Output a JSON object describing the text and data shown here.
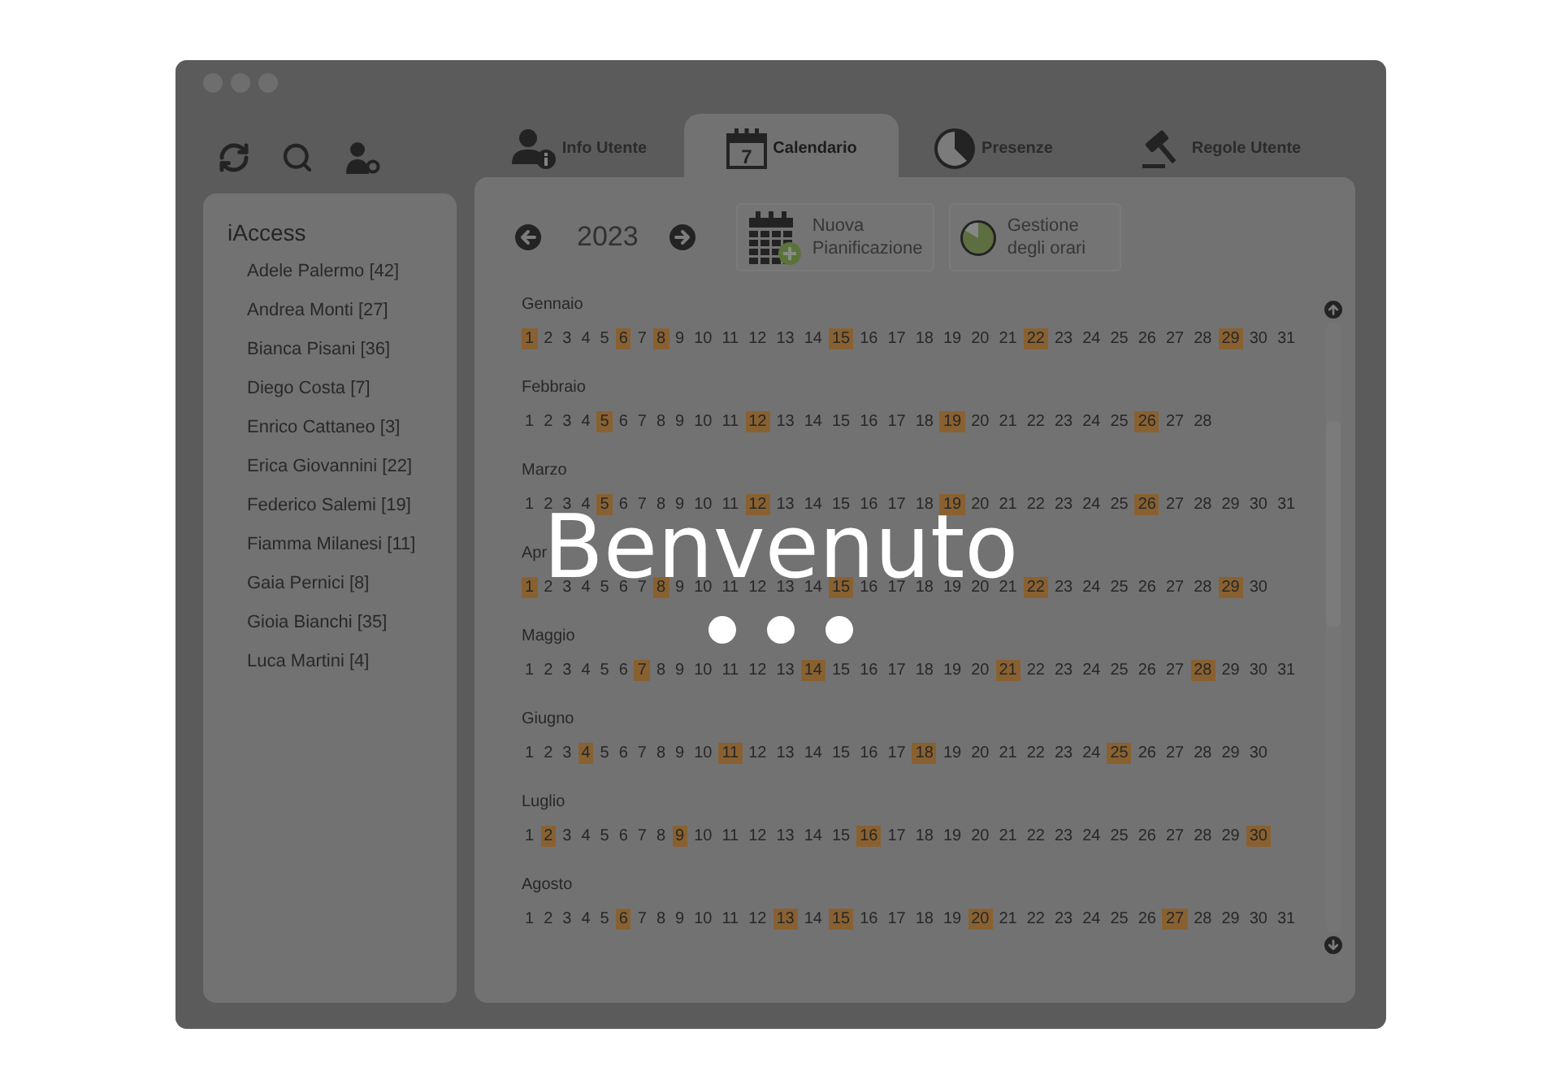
{
  "sidebar": {
    "title": "iAccess",
    "items": [
      "Adele Palermo [42]",
      "Andrea Monti [27]",
      "Bianca Pisani [36]",
      "Diego Costa [7]",
      "Enrico Cattaneo [3]",
      "Erica Giovannini [22]",
      "Federico Salemi [19]",
      "Fiamma Milanesi [11]",
      "Gaia Pernici [8]",
      "Gioia Bianchi [35]",
      "Luca Martini [4]"
    ]
  },
  "tabs": [
    {
      "label": "Info Utente",
      "kind": "user",
      "selected": false
    },
    {
      "label": "Calendario",
      "kind": "calendar",
      "icon_text": "7",
      "selected": true
    },
    {
      "label": "Presenze",
      "kind": "clock",
      "selected": false
    },
    {
      "label": "Regole Utente",
      "kind": "gavel",
      "selected": false
    }
  ],
  "year_nav": {
    "year": "2023"
  },
  "actions": [
    {
      "label": "Nuova Pianificazione",
      "kind": "schedule"
    },
    {
      "label": "Gestione degli orari",
      "kind": "hours"
    }
  ],
  "calendar": {
    "months": [
      {
        "name": "Gennaio",
        "days": [
          {
            "day": "1",
            "marked": true
          },
          {
            "day": "2",
            "marked": false
          },
          {
            "day": "3",
            "marked": false
          },
          {
            "day": "4",
            "marked": false
          },
          {
            "day": "5",
            "marked": false
          },
          {
            "day": "6",
            "marked": true
          },
          {
            "day": "7",
            "marked": false
          },
          {
            "day": "8",
            "marked": true
          },
          {
            "day": "9",
            "marked": false
          },
          {
            "day": "10",
            "marked": false
          },
          {
            "day": "11",
            "marked": false
          },
          {
            "day": "12",
            "marked": false
          },
          {
            "day": "13",
            "marked": false
          },
          {
            "day": "14",
            "marked": false
          },
          {
            "day": "15",
            "marked": true
          },
          {
            "day": "16",
            "marked": false
          },
          {
            "day": "17",
            "marked": false
          },
          {
            "day": "18",
            "marked": false
          },
          {
            "day": "19",
            "marked": false
          },
          {
            "day": "20",
            "marked": false
          },
          {
            "day": "21",
            "marked": false
          },
          {
            "day": "22",
            "marked": true
          },
          {
            "day": "23",
            "marked": false
          },
          {
            "day": "24",
            "marked": false
          },
          {
            "day": "25",
            "marked": false
          },
          {
            "day": "26",
            "marked": false
          },
          {
            "day": "27",
            "marked": false
          },
          {
            "day": "28",
            "marked": false
          },
          {
            "day": "29",
            "marked": true
          },
          {
            "day": "30",
            "marked": false
          },
          {
            "day": "31",
            "marked": false
          }
        ]
      },
      {
        "name": "Febbraio",
        "days": [
          {
            "day": "1",
            "marked": false
          },
          {
            "day": "2",
            "marked": false
          },
          {
            "day": "3",
            "marked": false
          },
          {
            "day": "4",
            "marked": false
          },
          {
            "day": "5",
            "marked": true
          },
          {
            "day": "6",
            "marked": false
          },
          {
            "day": "7",
            "marked": false
          },
          {
            "day": "8",
            "marked": false
          },
          {
            "day": "9",
            "marked": false
          },
          {
            "day": "10",
            "marked": false
          },
          {
            "day": "11",
            "marked": false
          },
          {
            "day": "12",
            "marked": true
          },
          {
            "day": "13",
            "marked": false
          },
          {
            "day": "14",
            "marked": false
          },
          {
            "day": "15",
            "marked": false
          },
          {
            "day": "16",
            "marked": false
          },
          {
            "day": "17",
            "marked": false
          },
          {
            "day": "18",
            "marked": false
          },
          {
            "day": "19",
            "marked": true
          },
          {
            "day": "20",
            "marked": false
          },
          {
            "day": "21",
            "marked": false
          },
          {
            "day": "22",
            "marked": false
          },
          {
            "day": "23",
            "marked": false
          },
          {
            "day": "24",
            "marked": false
          },
          {
            "day": "25",
            "marked": false
          },
          {
            "day": "26",
            "marked": true
          },
          {
            "day": "27",
            "marked": false
          },
          {
            "day": "28",
            "marked": false
          }
        ]
      },
      {
        "name": "Marzo",
        "days": [
          {
            "day": "1",
            "marked": false
          },
          {
            "day": "2",
            "marked": false
          },
          {
            "day": "3",
            "marked": false
          },
          {
            "day": "4",
            "marked": false
          },
          {
            "day": "5",
            "marked": true
          },
          {
            "day": "6",
            "marked": false
          },
          {
            "day": "7",
            "marked": false
          },
          {
            "day": "8",
            "marked": false
          },
          {
            "day": "9",
            "marked": false
          },
          {
            "day": "10",
            "marked": false
          },
          {
            "day": "11",
            "marked": false
          },
          {
            "day": "12",
            "marked": true
          },
          {
            "day": "13",
            "marked": false
          },
          {
            "day": "14",
            "marked": false
          },
          {
            "day": "15",
            "marked": false
          },
          {
            "day": "16",
            "marked": false
          },
          {
            "day": "17",
            "marked": false
          },
          {
            "day": "18",
            "marked": false
          },
          {
            "day": "19",
            "marked": true
          },
          {
            "day": "20",
            "marked": false
          },
          {
            "day": "21",
            "marked": false
          },
          {
            "day": "22",
            "marked": false
          },
          {
            "day": "23",
            "marked": false
          },
          {
            "day": "24",
            "marked": false
          },
          {
            "day": "25",
            "marked": false
          },
          {
            "day": "26",
            "marked": true
          },
          {
            "day": "27",
            "marked": false
          },
          {
            "day": "28",
            "marked": false
          },
          {
            "day": "29",
            "marked": false
          },
          {
            "day": "30",
            "marked": false
          },
          {
            "day": "31",
            "marked": false
          }
        ]
      },
      {
        "name": "Apr",
        "days": [
          {
            "day": "1",
            "marked": true
          },
          {
            "day": "2",
            "marked": false
          },
          {
            "day": "3",
            "marked": false
          },
          {
            "day": "4",
            "marked": false
          },
          {
            "day": "5",
            "marked": false
          },
          {
            "day": "6",
            "marked": false
          },
          {
            "day": "7",
            "marked": false
          },
          {
            "day": "8",
            "marked": true
          },
          {
            "day": "9",
            "marked": false
          },
          {
            "day": "10",
            "marked": false
          },
          {
            "day": "11",
            "marked": false
          },
          {
            "day": "12",
            "marked": false
          },
          {
            "day": "13",
            "marked": false
          },
          {
            "day": "14",
            "marked": false
          },
          {
            "day": "15",
            "marked": true
          },
          {
            "day": "16",
            "marked": false
          },
          {
            "day": "17",
            "marked": false
          },
          {
            "day": "18",
            "marked": false
          },
          {
            "day": "19",
            "marked": false
          },
          {
            "day": "20",
            "marked": false
          },
          {
            "day": "21",
            "marked": false
          },
          {
            "day": "22",
            "marked": true
          },
          {
            "day": "23",
            "marked": false
          },
          {
            "day": "24",
            "marked": false
          },
          {
            "day": "25",
            "marked": false
          },
          {
            "day": "26",
            "marked": false
          },
          {
            "day": "27",
            "marked": false
          },
          {
            "day": "28",
            "marked": false
          },
          {
            "day": "29",
            "marked": true
          },
          {
            "day": "30",
            "marked": false
          }
        ]
      },
      {
        "name": "Maggio",
        "days": [
          {
            "day": "1",
            "marked": false
          },
          {
            "day": "2",
            "marked": false
          },
          {
            "day": "3",
            "marked": false
          },
          {
            "day": "4",
            "marked": false
          },
          {
            "day": "5",
            "marked": false
          },
          {
            "day": "6",
            "marked": false
          },
          {
            "day": "7",
            "marked": true
          },
          {
            "day": "8",
            "marked": false
          },
          {
            "day": "9",
            "marked": false
          },
          {
            "day": "10",
            "marked": false
          },
          {
            "day": "11",
            "marked": false
          },
          {
            "day": "12",
            "marked": false
          },
          {
            "day": "13",
            "marked": false
          },
          {
            "day": "14",
            "marked": true
          },
          {
            "day": "15",
            "marked": false
          },
          {
            "day": "16",
            "marked": false
          },
          {
            "day": "17",
            "marked": false
          },
          {
            "day": "18",
            "marked": false
          },
          {
            "day": "19",
            "marked": false
          },
          {
            "day": "20",
            "marked": false
          },
          {
            "day": "21",
            "marked": true
          },
          {
            "day": "22",
            "marked": false
          },
          {
            "day": "23",
            "marked": false
          },
          {
            "day": "24",
            "marked": false
          },
          {
            "day": "25",
            "marked": false
          },
          {
            "day": "26",
            "marked": false
          },
          {
            "day": "27",
            "marked": false
          },
          {
            "day": "28",
            "marked": true
          },
          {
            "day": "29",
            "marked": false
          },
          {
            "day": "30",
            "marked": false
          },
          {
            "day": "31",
            "marked": false
          }
        ]
      },
      {
        "name": "Giugno",
        "days": [
          {
            "day": "1",
            "marked": false
          },
          {
            "day": "2",
            "marked": false
          },
          {
            "day": "3",
            "marked": false
          },
          {
            "day": "4",
            "marked": true
          },
          {
            "day": "5",
            "marked": false
          },
          {
            "day": "6",
            "marked": false
          },
          {
            "day": "7",
            "marked": false
          },
          {
            "day": "8",
            "marked": false
          },
          {
            "day": "9",
            "marked": false
          },
          {
            "day": "10",
            "marked": false
          },
          {
            "day": "11",
            "marked": true
          },
          {
            "day": "12",
            "marked": false
          },
          {
            "day": "13",
            "marked": false
          },
          {
            "day": "14",
            "marked": false
          },
          {
            "day": "15",
            "marked": false
          },
          {
            "day": "16",
            "marked": false
          },
          {
            "day": "17",
            "marked": false
          },
          {
            "day": "18",
            "marked": true
          },
          {
            "day": "19",
            "marked": false
          },
          {
            "day": "20",
            "marked": false
          },
          {
            "day": "21",
            "marked": false
          },
          {
            "day": "22",
            "marked": false
          },
          {
            "day": "23",
            "marked": false
          },
          {
            "day": "24",
            "marked": false
          },
          {
            "day": "25",
            "marked": true
          },
          {
            "day": "26",
            "marked": false
          },
          {
            "day": "27",
            "marked": false
          },
          {
            "day": "28",
            "marked": false
          },
          {
            "day": "29",
            "marked": false
          },
          {
            "day": "30",
            "marked": false
          }
        ]
      },
      {
        "name": "Luglio",
        "days": [
          {
            "day": "1",
            "marked": false
          },
          {
            "day": "2",
            "marked": true
          },
          {
            "day": "3",
            "marked": false
          },
          {
            "day": "4",
            "marked": false
          },
          {
            "day": "5",
            "marked": false
          },
          {
            "day": "6",
            "marked": false
          },
          {
            "day": "7",
            "marked": false
          },
          {
            "day": "8",
            "marked": false
          },
          {
            "day": "9",
            "marked": true
          },
          {
            "day": "10",
            "marked": false
          },
          {
            "day": "11",
            "marked": false
          },
          {
            "day": "12",
            "marked": false
          },
          {
            "day": "13",
            "marked": false
          },
          {
            "day": "14",
            "marked": false
          },
          {
            "day": "15",
            "marked": false
          },
          {
            "day": "16",
            "marked": true
          },
          {
            "day": "17",
            "marked": false
          },
          {
            "day": "18",
            "marked": false
          },
          {
            "day": "19",
            "marked": false
          },
          {
            "day": "20",
            "marked": false
          },
          {
            "day": "21",
            "marked": false
          },
          {
            "day": "22",
            "marked": false
          },
          {
            "day": "23",
            "marked": false
          },
          {
            "day": "24",
            "marked": false
          },
          {
            "day": "25",
            "marked": false
          },
          {
            "day": "26",
            "marked": false
          },
          {
            "day": "27",
            "marked": false
          },
          {
            "day": "28",
            "marked": false
          },
          {
            "day": "29",
            "marked": false
          },
          {
            "day": "30",
            "marked": true
          }
        ]
      },
      {
        "name": "Agosto",
        "days": [
          {
            "day": "1",
            "marked": false
          },
          {
            "day": "2",
            "marked": false
          },
          {
            "day": "3",
            "marked": false
          },
          {
            "day": "4",
            "marked": false
          },
          {
            "day": "5",
            "marked": false
          },
          {
            "day": "6",
            "marked": true
          },
          {
            "day": "7",
            "marked": false
          },
          {
            "day": "8",
            "marked": false
          },
          {
            "day": "9",
            "marked": false
          },
          {
            "day": "10",
            "marked": false
          },
          {
            "day": "11",
            "marked": false
          },
          {
            "day": "12",
            "marked": false
          },
          {
            "day": "13",
            "marked": true
          },
          {
            "day": "14",
            "marked": false
          },
          {
            "day": "15",
            "marked": true
          },
          {
            "day": "16",
            "marked": false
          },
          {
            "day": "17",
            "marked": false
          },
          {
            "day": "18",
            "marked": false
          },
          {
            "day": "19",
            "marked": false
          },
          {
            "day": "20",
            "marked": true
          },
          {
            "day": "21",
            "marked": false
          },
          {
            "day": "22",
            "marked": false
          },
          {
            "day": "23",
            "marked": false
          },
          {
            "day": "24",
            "marked": false
          },
          {
            "day": "25",
            "marked": false
          },
          {
            "day": "26",
            "marked": false
          },
          {
            "day": "27",
            "marked": true
          },
          {
            "day": "28",
            "marked": false
          },
          {
            "day": "29",
            "marked": false
          },
          {
            "day": "30",
            "marked": false
          },
          {
            "day": "31",
            "marked": false
          }
        ]
      }
    ]
  },
  "loading": {
    "title": "Benvenuto"
  }
}
